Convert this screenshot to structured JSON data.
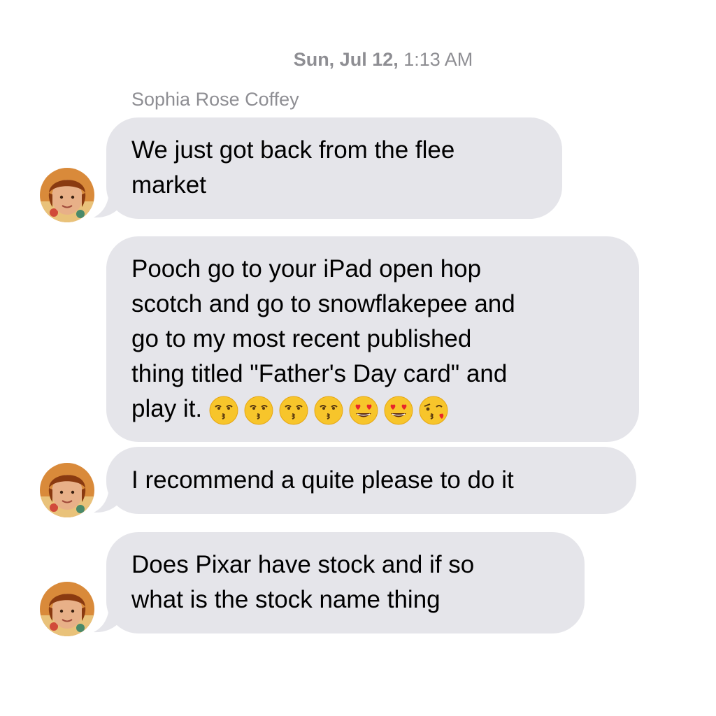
{
  "conversation": {
    "timestamp_day": "Sun, Jul 12,",
    "timestamp_time": " 1:13 AM",
    "sender_name": "Sophia Rose Coffey",
    "bubble_color": "#e5e5ea",
    "meta_text_color": "#8e8e93",
    "messages": [
      {
        "text": "We just got back from the flee\nmarket"
      },
      {
        "text": "Pooch go to your iPad open hop\nscotch and go to snowflakepee and\ngo to my most recent published\nthing titled \"Father's Day card\" and\nplay it.",
        "emojis": [
          "kissing-face-with-closed-eyes",
          "kissing-face-with-closed-eyes",
          "kissing-face-with-closed-eyes",
          "kissing-face-with-closed-eyes",
          "smiling-face-with-heart-eyes",
          "smiling-face-with-heart-eyes",
          "face-blowing-a-kiss"
        ]
      },
      {
        "text": "I recommend a quite please to do it"
      },
      {
        "text": "Does Pixar have stock and if so\nwhat is the stock name thing"
      }
    ]
  }
}
